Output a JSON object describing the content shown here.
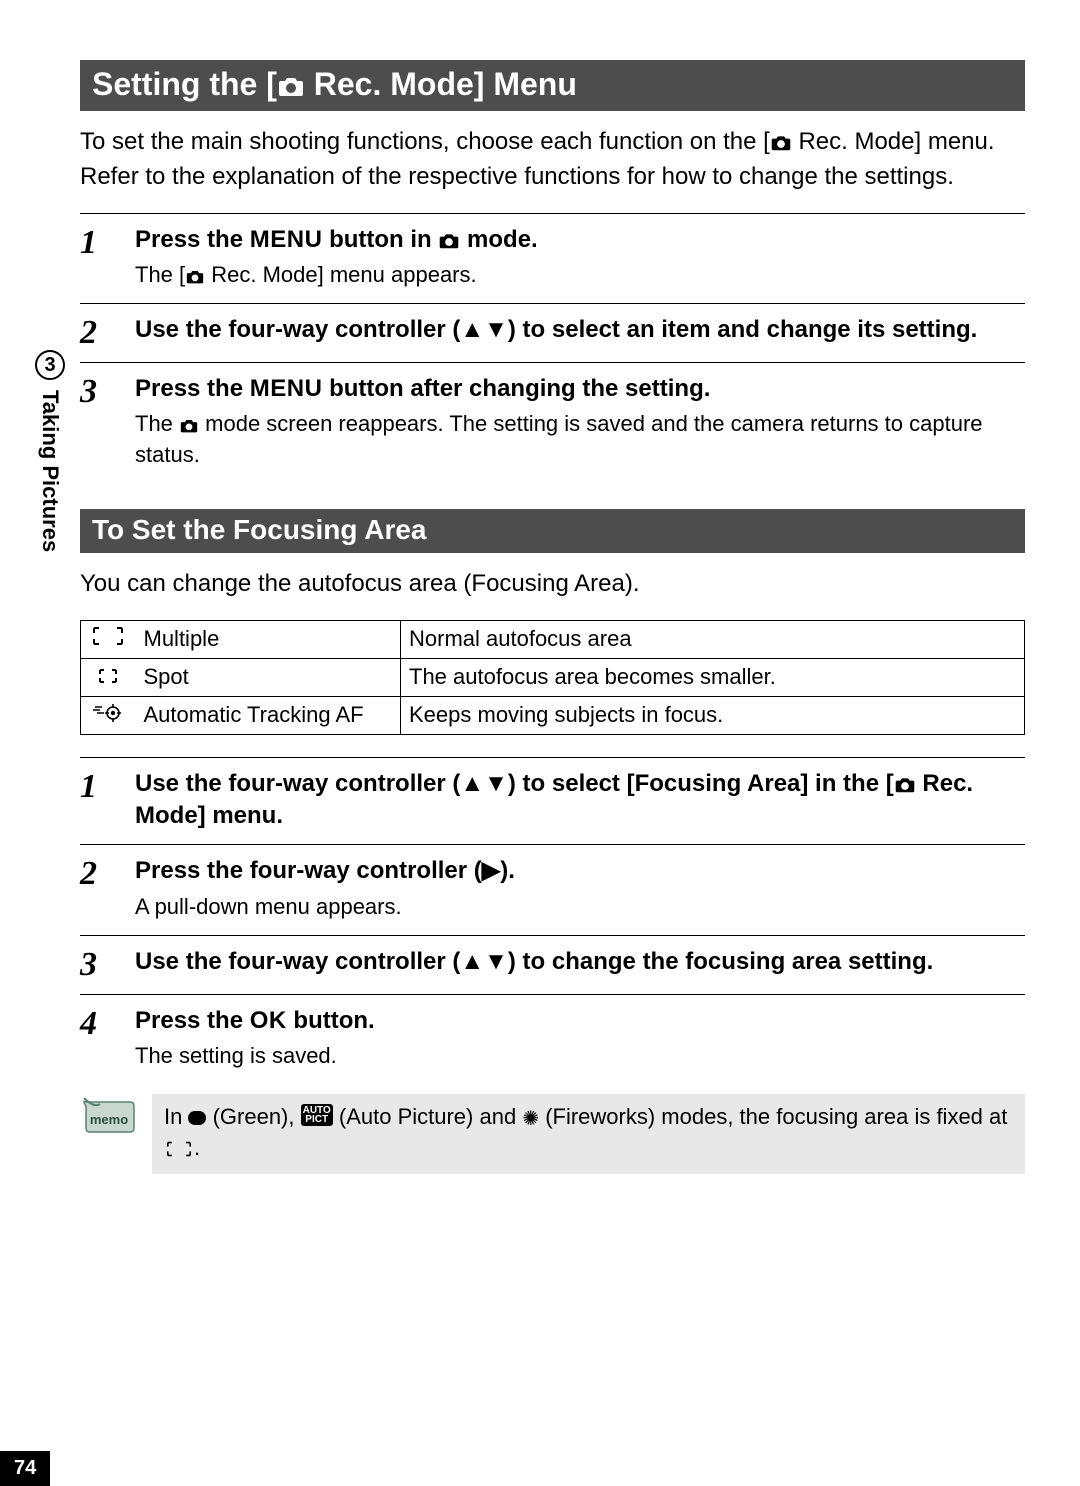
{
  "sidebar": {
    "chapter_num": "3",
    "chapter_label": "Taking Pictures"
  },
  "page_number": "74",
  "section1": {
    "title_pre": "Setting the [",
    "title_post": " Rec. Mode] Menu",
    "intro_pre": "To set the main shooting functions, choose each function on the [",
    "intro_post": " Rec. Mode] menu. Refer to the explanation of the respective functions for how to change the settings.",
    "steps": [
      {
        "num": "1",
        "title_pre": "Press the ",
        "title_menu": "MENU",
        "title_mid": " button in ",
        "title_post": " mode.",
        "desc_pre": "The [",
        "desc_post": " Rec. Mode] menu appears."
      },
      {
        "num": "2",
        "title": "Use the four-way controller (▲▼) to select an item and change its setting."
      },
      {
        "num": "3",
        "title_pre": "Press the ",
        "title_menu": "MENU",
        "title_post": " button after changing the setting.",
        "desc_pre": "The ",
        "desc_post": " mode screen reappears. The setting is saved and the camera returns to capture status."
      }
    ]
  },
  "section2": {
    "title": "To Set the Focusing Area",
    "intro": "You can change the autofocus area (Focusing Area).",
    "table": [
      {
        "name": "Multiple",
        "desc": "Normal autofocus area"
      },
      {
        "name": "Spot",
        "desc": "The autofocus area becomes smaller."
      },
      {
        "name": "Automatic Tracking AF",
        "desc": "Keeps moving subjects in focus."
      }
    ],
    "steps": [
      {
        "num": "1",
        "title_pre": "Use the four-way controller (▲▼) to select [Focusing Area] in the [",
        "title_post": " Rec. Mode] menu."
      },
      {
        "num": "2",
        "title": "Press the four-way controller (▶).",
        "desc": "A pull-down menu appears."
      },
      {
        "num": "3",
        "title": "Use the four-way controller (▲▼) to change the focusing area setting."
      },
      {
        "num": "4",
        "title_pre": "Press the ",
        "title_ok": "OK",
        "title_post": " button.",
        "desc": "The setting is saved."
      }
    ],
    "memo_pre": "In ",
    "memo_green": " (Green), ",
    "memo_autopict": " (Auto Picture) and ",
    "memo_fire": " (Fireworks) modes, the focusing area is fixed at ",
    "memo_post": "."
  }
}
